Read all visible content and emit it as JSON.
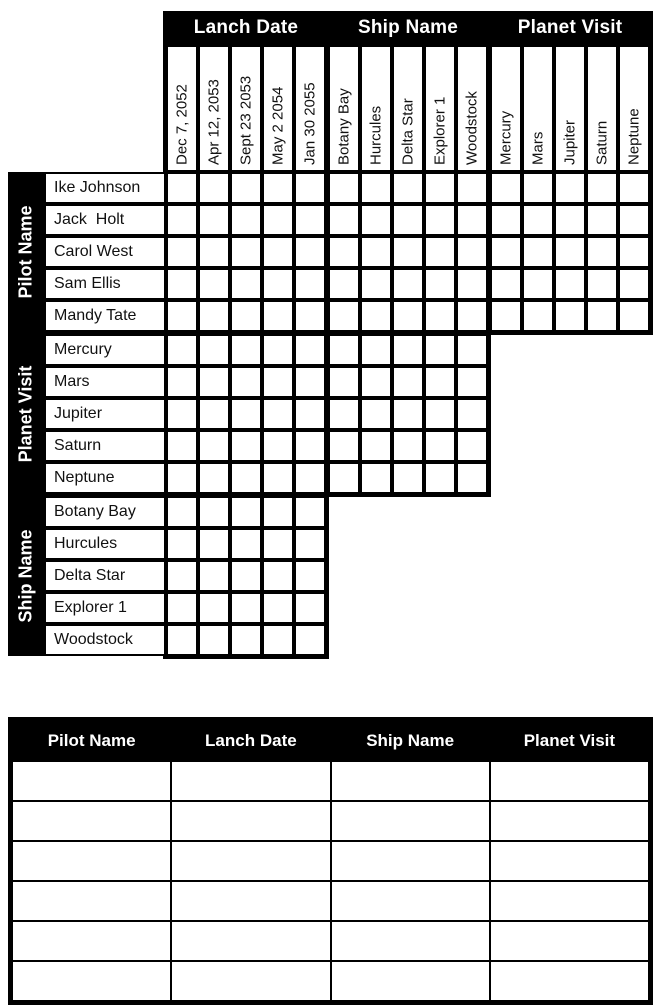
{
  "puzzle": {
    "categories": {
      "pilot_name": "Pilot Name",
      "lanch_date": "Lanch Date",
      "ship_name": "Ship Name",
      "planet_visit": "Planet Visit"
    },
    "column_groups": [
      {
        "label": "Lanch Date",
        "items": [
          "Dec 7, 2052",
          "Apr 12, 2053",
          "Sept 23 2053",
          "May 2 2054",
          "Jan 30 2055"
        ]
      },
      {
        "label": "Ship Name",
        "items": [
          "Botany Bay",
          "Hurcules",
          "Delta Star",
          "Explorer 1",
          "Woodstock"
        ]
      },
      {
        "label": "Planet Visit",
        "items": [
          "Mercury",
          "Mars",
          "Jupiter",
          "Saturn",
          "Neptune"
        ]
      }
    ],
    "row_groups": [
      {
        "label": "Pilot Name",
        "items": [
          "Ike Johnson",
          "Jack  Holt",
          "Carol West",
          "Sam Ellis",
          "Mandy Tate"
        ],
        "column_group_count": 3
      },
      {
        "label": "Planet Visit",
        "items": [
          "Mercury",
          "Mars",
          "Jupiter",
          "Saturn",
          "Neptune"
        ],
        "column_group_count": 2
      },
      {
        "label": "Ship Name",
        "items": [
          "Botany Bay",
          "Hurcules",
          "Delta Star",
          "Explorer 1",
          "Woodstock"
        ],
        "column_group_count": 1
      }
    ]
  },
  "answer_table": {
    "headers": [
      "Pilot Name",
      "Lanch Date",
      "Ship Name",
      "Planet Visit"
    ],
    "rows": [
      [
        "",
        "",
        "",
        ""
      ],
      [
        "",
        "",
        "",
        ""
      ],
      [
        "",
        "",
        "",
        ""
      ],
      [
        "",
        "",
        "",
        ""
      ],
      [
        "",
        "",
        "",
        ""
      ],
      [
        "",
        "",
        "",
        ""
      ]
    ]
  },
  "colors": {
    "header_bg": "#000000",
    "header_text": "#ffffff",
    "cell_bg": "#ffffff",
    "grid_line": "#000000",
    "label_text": "#111111"
  }
}
